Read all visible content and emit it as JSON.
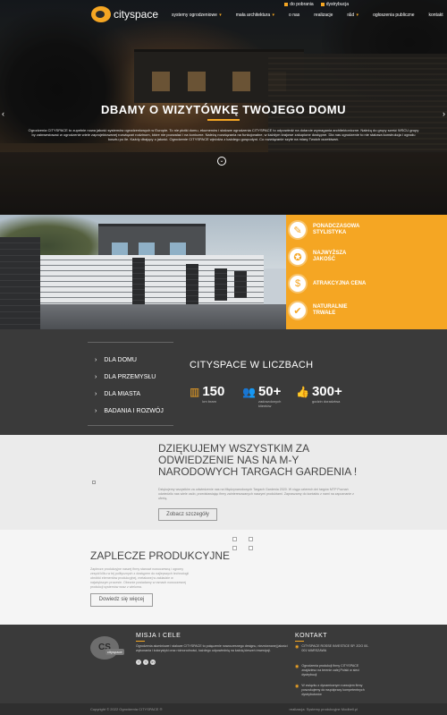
{
  "colors": {
    "accent": "#f5a623",
    "dark": "#3a3a3a",
    "light": "#ebebeb"
  },
  "toplinks": {
    "downloads": "do pobrania",
    "distribution": "dystrybucja"
  },
  "logo": {
    "text": "cityspace"
  },
  "menu": [
    {
      "label": "systemy ogrodzeniowe",
      "has_dropdown": true
    },
    {
      "label": "mała architektura",
      "has_dropdown": true
    },
    {
      "label": "o nas",
      "has_dropdown": false
    },
    {
      "label": "realizacje",
      "has_dropdown": false
    },
    {
      "label": "r&d",
      "has_dropdown": true
    },
    {
      "label": "ogłoszenia publiczne",
      "has_dropdown": false
    },
    {
      "label": "kontakt",
      "has_dropdown": false
    }
  ],
  "hero": {
    "title": "DBAMY O WIZYTÓWKĘ TWOJEGO DOMU",
    "text": "Ogrodzenia CITYSPACE to zupełnie nowa jakość systemów ogrodzeniowych w Europie. To nie płotki domu, ekumenów i stalowe ogrodzenia CITYSPACE to odpowiedź na dotarcie wymagania architektoniczne. Należą do grupy sześć WSCU grupy by zainwestować w ogrodzenie wiele zaprojektowanej rozwiązań rodzinom, które nie pozwalać i na koniczne. Należą rozwiązania na funkcjonalne, w każdym krajowe zakupione dostępne. Dla nas ogrodzenie to nie stalowa konstrukcja i ogrodu kosztu po ile. Każdy dbający o jakość. Ogrodzenie CITYSPACE wjeżdża z każdego gospodyni. Co rozwiązanie szyte na miarę Twoich oczekiwań.",
    "prev_icon": "chevron-left",
    "next_icon": "chevron-right",
    "scroll_icon": "chevron-down"
  },
  "features": [
    {
      "label": "PONADCZASOWA STYLISTYKA",
      "icon": "pen-icon",
      "glyph": "✎"
    },
    {
      "label": "NAJWYŻSZA JAKOŚĆ",
      "icon": "medal-icon",
      "glyph": "✪"
    },
    {
      "label": "ATRAKCYJNA CENA",
      "icon": "tag-icon",
      "glyph": "$"
    },
    {
      "label": "NATURALNIE TRWAŁE",
      "icon": "shield-icon",
      "glyph": "✔"
    }
  ],
  "side_menu": [
    {
      "label": "DLA DOMU"
    },
    {
      "label": "DLA PRZEMYSŁU"
    },
    {
      "label": "DLA MIASTA"
    },
    {
      "label": "BADANIA I ROZWÓJ"
    }
  ],
  "stats": {
    "title": "CITYSPACE W LICZBACH",
    "items": [
      {
        "value": "150",
        "label": "km bram",
        "icon": "fence-icon",
        "glyph": "▥"
      },
      {
        "value": "50+",
        "label": "zadowolonych klientów",
        "icon": "users-icon",
        "glyph": "👥"
      },
      {
        "value": "300+",
        "label": "godzin doradztwa",
        "icon": "thumbs-up-icon",
        "glyph": "👍"
      }
    ]
  },
  "thanks": {
    "title": "DZIĘKUJEMY WSZYSTKIM ZA ODWIEDZENIE NAS NA M-Y NARODOWYCH TARGACH GARDENIA !",
    "text": "Dziękujemy wszystkim za odwiedzenie nas na Międzynarodowych Targach Gardenia 2020. W ciągu czterech dni targów MTP Poznań odwiedziło nas wiele osób, przedstawiając firmy zainteresowanych naszymi produktami. Zapraszamy do kontaktu z nami na zapoznanie z ofertą.",
    "button": "Zobacz szczegóły"
  },
  "production": {
    "title": "ZAPLECZE PRODUKCYJNE",
    "text": "Zaplecze produkcyjne naszej firmy stanowi nowoczesną i ogromy zespół kilku w tej politycznych z dostępem do najlepszych technologii obróbki elementów produkcyjnej, metalowej w zakładzie w największym procesie. Obecnie posiadamy w ramach nowoczesnej produkcji systemów wraz z wieloma.",
    "button": "Dowiedz się więcej"
  },
  "footer": {
    "logo_text": "CS",
    "logo_sub": "cityspace",
    "mission_title": "MISJA I CELE",
    "mission_text": "Ogrodzenia aluminiowe i stalowe CITYSPACE to połączenie nowoczesnego designu, niezrównanej jakości wykonania i kolorystyki oraz różnorodności, każdego odpowiednią na każdą kieszeń inwestycji.",
    "socials": [
      "f",
      "t",
      "in"
    ],
    "contact_title": "KONTAKT",
    "contact": [
      "CITYSPACE ROSSE INVESTICE SP. ZOO 00-001 WARSZAWA",
      "Ogrodzenia produkcji firmy CITYSPACE znajdziesz na terenie całej Polski w sieci dystrybucji",
      "W związku z dynamicznym rozwojem firmy poszukujemy do współpracy kompetentnych dystrybutorów"
    ],
    "copyright": "Copyright © 2022 Ogrodzenia CITYSPACE ®",
    "credits": "realizacja: Systemy produkcyjne Modbell.pl"
  }
}
